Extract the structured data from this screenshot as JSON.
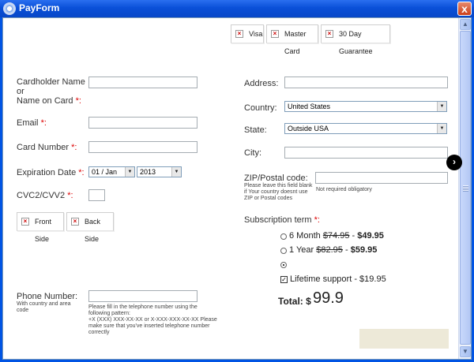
{
  "window": {
    "title": "PayForm",
    "close_label": "x"
  },
  "badges": [
    {
      "label": "Visa"
    },
    {
      "label": "Master Card"
    },
    {
      "label": "30 Day Guarantee"
    }
  ],
  "card_form": {
    "cardholder_lines": [
      "Cardholder Name",
      "or",
      "Name on Card"
    ],
    "email_label": "Email",
    "card_number_label": "Card Number",
    "expiration_label": "Expiration Date",
    "expiration_month": "01 / Jan",
    "expiration_year": "2013",
    "cvc_label": "CVC2/CVV2",
    "required_mark": "*:"
  },
  "card_side_tabs": [
    {
      "label": "Front Side"
    },
    {
      "label": "Back Side"
    }
  ],
  "phone": {
    "label": "Phone Number:",
    "hint_lines": [
      "With country and area",
      "code"
    ],
    "pattern_lines": [
      "Please fill in the telephone number using the",
      "following pattern:",
      "+X (XXX) XXX-XX-XX or X-XXX-XXX-XX-XX Please",
      "make sure that you've inserted telephone number",
      "correctly"
    ]
  },
  "address_form": {
    "address_label": "Address:",
    "country_label": "Country:",
    "country_value": "United States",
    "state_label": "State:",
    "state_value": "Outside USA",
    "city_label": "City:",
    "zip_label": "ZIP/Postal code:",
    "zip_hint_lines": [
      "Please leave this field blank",
      "if Your country doesnt use",
      "ZIP or Postal codes"
    ],
    "zip_note": "Not required obligatory"
  },
  "subscription": {
    "label": "Subscription term",
    "required_mark": "*:",
    "options": [
      {
        "term": "6 Month",
        "old_price": "$74.95",
        "separator": "-",
        "new_price": "$49.95",
        "selected": false
      },
      {
        "term": "1 Year",
        "old_price": "$82.95",
        "separator": "-",
        "new_price": "$59.95",
        "selected": false
      }
    ],
    "third_option_selected": true,
    "lifetime": {
      "label": "Lifetime support - $19.95",
      "checked": true
    },
    "total_label": "Total:",
    "total_currency": "$",
    "total_value": "99.9"
  },
  "icons": {
    "next": "chevron-right-icon",
    "close": "close-icon",
    "broken_image": "broken-image-icon"
  }
}
